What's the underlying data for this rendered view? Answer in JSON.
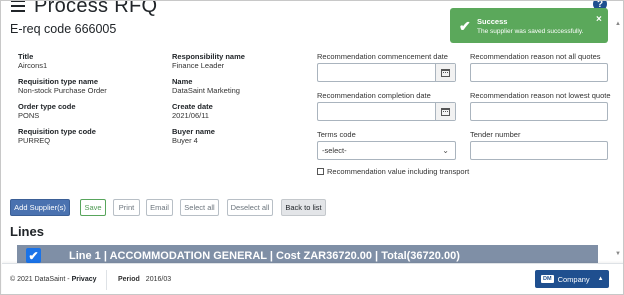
{
  "header": {
    "title": "Process RFQ",
    "ereq": "E-req code 666005",
    "help": "?"
  },
  "info_left": [
    {
      "label": "Title",
      "value": "Aircons1"
    },
    {
      "label": "Requisition type name",
      "value": "Non-stock Purchase Order"
    },
    {
      "label": "Order type code",
      "value": "PONS"
    },
    {
      "label": "Requisition type code",
      "value": "PURREQ"
    }
  ],
  "info_mid": [
    {
      "label": "Responsibility name",
      "value": "Finance Leader"
    },
    {
      "label": "Name",
      "value": "DataSaint Marketing"
    },
    {
      "label": "Create date",
      "value": "2021/06/11"
    },
    {
      "label": "Buyer name",
      "value": "Buyer 4"
    }
  ],
  "form": {
    "commencement_label": "Recommendation commencement date",
    "completion_label": "Recommendation completion date",
    "terms_label": "Terms code",
    "terms_value": "-select-",
    "reason_quotes_label": "Recommendation reason not all quotes",
    "reason_lowest_label": "Recommendation reason not lowest quote",
    "tender_label": "Tender number",
    "incl_transport_label": "Recommendation value including transport"
  },
  "toast": {
    "title": "Success",
    "message": "The supplier was saved successfully.",
    "close": "×",
    "check": "✔"
  },
  "buttons": {
    "add_supplier": "Add Supplier(s)",
    "save": "Save",
    "print": "Print",
    "email": "Email",
    "select_all": "Select all",
    "deselect_all": "Deselect all",
    "back": "Back to list"
  },
  "lines": {
    "heading": "Lines",
    "line1": "Line 1 | ACCOMMODATION GENERAL | Cost ZAR36720.00 | Total(36720.00)",
    "check": "✔"
  },
  "footer": {
    "copyright": "© 2021 DataSaint - ",
    "privacy": "Privacy",
    "period_label": "Period",
    "period_value": "2016/03",
    "company_badge": "DM",
    "company_label": "Company",
    "caret": "▲"
  },
  "icons": {
    "menu": "hamburger-icon",
    "help": "help-icon",
    "calendar": "calendar-icon",
    "chevron": "chevron-down-icon"
  },
  "colors": {
    "toast_bg": "#5ba85b",
    "primary": "#4a72b0",
    "line_bar": "#7f8fa6",
    "company_bg": "#1f4f8f"
  }
}
